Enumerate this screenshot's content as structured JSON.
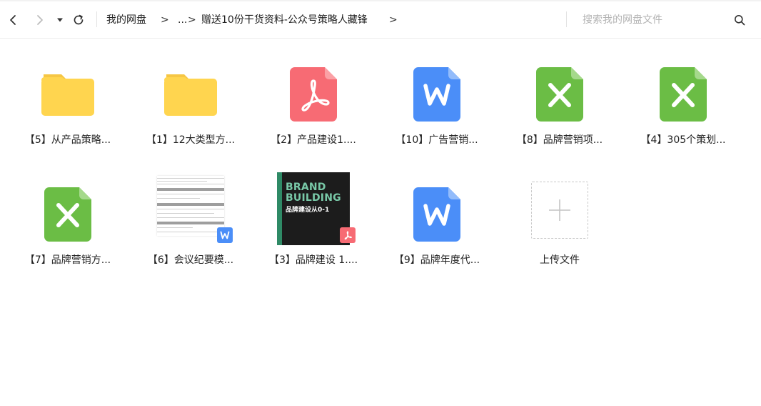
{
  "toolbar": {
    "breadcrumb": {
      "root": "我的网盘",
      "sep1": ">",
      "ellipsis": "...",
      "sep2": ">",
      "current": "赠送10份干货资料-公众号策略人藏锋",
      "sep3": ">"
    },
    "search": {
      "placeholder": "搜索我的网盘文件",
      "value": ""
    }
  },
  "files": [
    {
      "name": "【5】从产品策略...",
      "type": "folder"
    },
    {
      "name": "【1】12大类型方...",
      "type": "folder"
    },
    {
      "name": "【2】产品建设1....",
      "type": "pdf"
    },
    {
      "name": "【10】广告营销...",
      "type": "word"
    },
    {
      "name": "【8】品牌营销项...",
      "type": "excel"
    },
    {
      "name": "【4】305个策划...",
      "type": "excel"
    },
    {
      "name": "【7】品牌营销方...",
      "type": "excel"
    },
    {
      "name": "【6】会议纪要模...",
      "type": "word-thumbnail"
    },
    {
      "name": "【3】品牌建设 1....",
      "type": "pdf-thumbnail",
      "thumb_text": {
        "title_line1": "BRAND",
        "title_line2": "BUILDING",
        "subtitle": "品牌建设从0-1"
      }
    },
    {
      "name": "【9】品牌年度代...",
      "type": "word"
    }
  ],
  "upload": {
    "label": "上传文件"
  },
  "colors": {
    "folder": "#ffd54f",
    "folder_tab": "#f6c644",
    "pdf": "#f76b74",
    "word": "#4b8ef8",
    "excel": "#6bbd45"
  },
  "icons": {
    "back": "chevron-left-icon",
    "forward": "chevron-right-icon",
    "history": "caret-down-icon",
    "refresh": "refresh-icon",
    "search": "search-icon",
    "upload": "plus-icon"
  }
}
